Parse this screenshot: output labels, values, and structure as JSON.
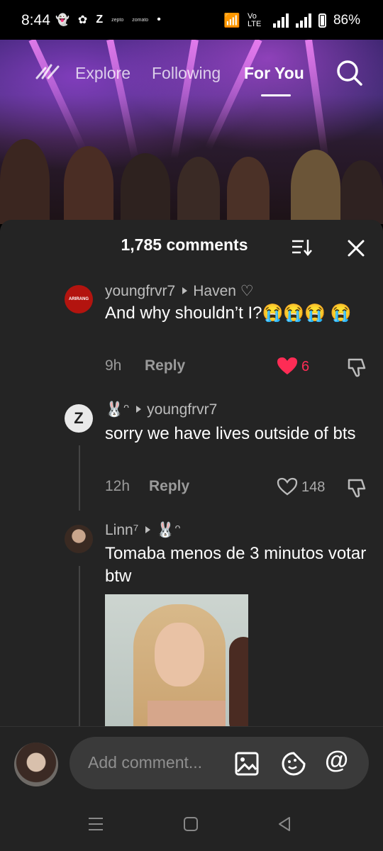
{
  "status_bar": {
    "time": "8:44",
    "app_icons": [
      "snapchat-icon",
      "app-icon",
      "z-icon",
      "zepto",
      "zomato",
      "dot"
    ],
    "tiny_labels": [
      "zepto",
      "zomato"
    ],
    "network": "Vo LTE",
    "battery": "86%"
  },
  "top_nav": {
    "tabs": [
      {
        "label": "Explore"
      },
      {
        "label": "Following"
      },
      {
        "label": "For You",
        "active": true
      }
    ]
  },
  "comments_panel": {
    "title": "1,785 comments",
    "comments": [
      {
        "avatar_text": "ARIRANG",
        "username": "youngfrvr7",
        "reply_to": "Haven ♡",
        "text": "And why shouldn’t I?😭😭😭 😭",
        "time": "9h",
        "reply_label": "Reply",
        "likes": "6",
        "liked": true
      },
      {
        "username": "🐰ᵔ",
        "reply_to": "youngfrvr7",
        "text": "sorry we have lives outside of bts",
        "time": "12h",
        "reply_label": "Reply",
        "likes": "148",
        "liked": false
      },
      {
        "username": "Linn⁷",
        "reply_to": "🐰ᵔ",
        "text": "Tomaba menos de 3 minutos votar btw",
        "has_image": true
      }
    ]
  },
  "bottom_bar": {
    "placeholder": "Add comment..."
  },
  "colors": {
    "panel_bg": "#242424",
    "like_red": "#fe2c55"
  }
}
